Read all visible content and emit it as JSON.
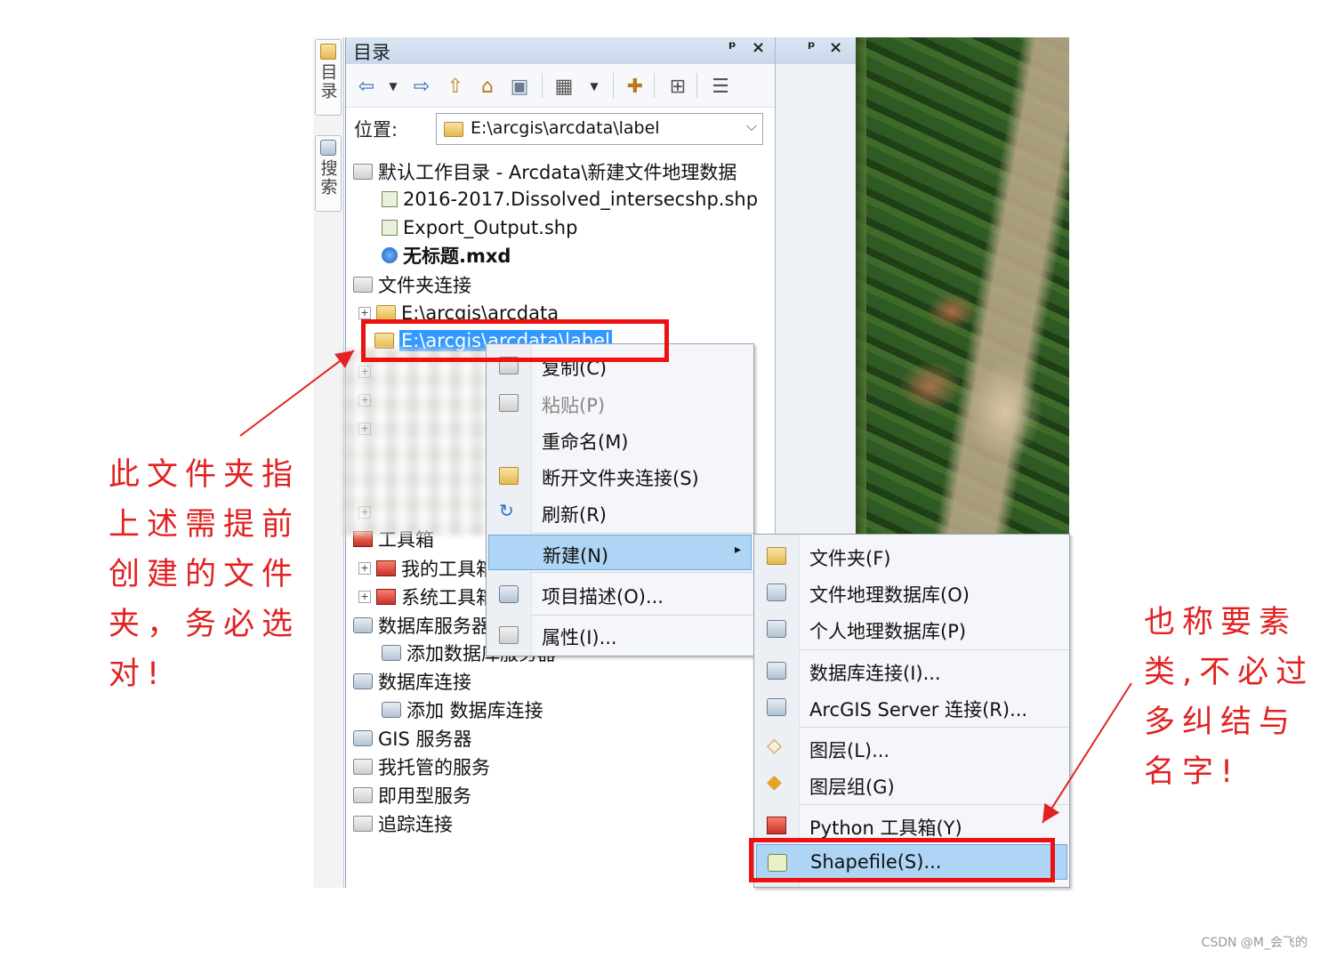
{
  "side_tabs": [
    {
      "label": "目录"
    },
    {
      "label": "搜索"
    }
  ],
  "catalog": {
    "title": "目录",
    "pin_icon": "pin-icon",
    "close_label": "×",
    "location_label": "位置:",
    "location_value": "E:\\arcgis\\arcdata\\label",
    "tree": {
      "r0": "默认工作目录 - Arcdata\\新建文件地理数据",
      "r1": "2016-2017.Dissolved_intersecshp.shp",
      "r2": "Export_Output.shp",
      "r3": "无标题.mxd",
      "r4": "文件夹连接",
      "r5": "E:\\arcgis\\arcdata",
      "r6": "E:\\arcgis\\arcdata\\label",
      "r7": "工具箱",
      "r8": "我的工具箱",
      "r9": "系统工具箱",
      "r10": "数据库服务器",
      "r11": "添加数据库服务器",
      "r12": "数据库连接",
      "r13": "添加 数据库连接",
      "r14": "GIS 服务器",
      "r15": "我托管的服务",
      "r16": "即用型服务",
      "r17": "追踪连接"
    }
  },
  "panel2": {
    "pin_label": "ᵖ",
    "close_label": "×"
  },
  "context_menu": {
    "copy": "复制(C)",
    "paste": "粘贴(P)",
    "rename": "重命名(M)",
    "disconnect": "断开文件夹连接(S)",
    "refresh": "刷新(R)",
    "new": "新建(N)",
    "item_desc": "项目描述(O)...",
    "properties": "属性(I)..."
  },
  "submenu": {
    "folder": "文件夹(F)",
    "file_gdb": "文件地理数据库(O)",
    "personal_gdb": "个人地理数据库(P)",
    "db_conn": "数据库连接(I)...",
    "server_conn": "ArcGIS Server 连接(R)...",
    "layer": "图层(L)...",
    "group_layer": "图层组(G)",
    "python_toolbox": "Python 工具箱(Y)",
    "shapefile": "Shapefile(S)..."
  },
  "annotations": {
    "left": [
      "此文件夹指",
      "上述需提前",
      "创建的文件",
      "夹，务必选",
      "对!"
    ],
    "right": [
      "也称要素",
      "类,不必过",
      "多纠结与",
      "名字!"
    ]
  },
  "watermark": "CSDN @M_会飞的",
  "colors": {
    "annotation": "#e22222",
    "selection": "#3399ff",
    "menu_highlight": "#aed5f5"
  }
}
